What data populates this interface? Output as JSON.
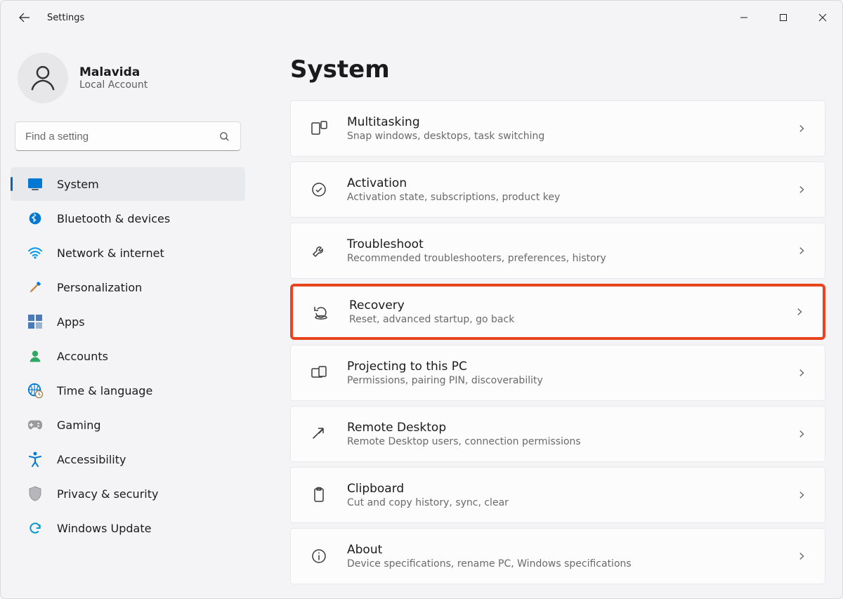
{
  "window": {
    "title": "Settings"
  },
  "profile": {
    "name": "Malavida",
    "account_type": "Local Account"
  },
  "search": {
    "placeholder": "Find a setting"
  },
  "nav": {
    "items": [
      {
        "id": "system",
        "label": "System",
        "selected": true
      },
      {
        "id": "bluetooth",
        "label": "Bluetooth & devices",
        "selected": false
      },
      {
        "id": "network",
        "label": "Network & internet",
        "selected": false
      },
      {
        "id": "personalization",
        "label": "Personalization",
        "selected": false
      },
      {
        "id": "apps",
        "label": "Apps",
        "selected": false
      },
      {
        "id": "accounts",
        "label": "Accounts",
        "selected": false
      },
      {
        "id": "time",
        "label": "Time & language",
        "selected": false
      },
      {
        "id": "gaming",
        "label": "Gaming",
        "selected": false
      },
      {
        "id": "accessibility",
        "label": "Accessibility",
        "selected": false
      },
      {
        "id": "privacy",
        "label": "Privacy & security",
        "selected": false
      },
      {
        "id": "update",
        "label": "Windows Update",
        "selected": false
      }
    ]
  },
  "page": {
    "title": "System",
    "cards": [
      {
        "id": "multitasking",
        "title": "Multitasking",
        "sub": "Snap windows, desktops, task switching",
        "highlighted": false
      },
      {
        "id": "activation",
        "title": "Activation",
        "sub": "Activation state, subscriptions, product key",
        "highlighted": false
      },
      {
        "id": "troubleshoot",
        "title": "Troubleshoot",
        "sub": "Recommended troubleshooters, preferences, history",
        "highlighted": false
      },
      {
        "id": "recovery",
        "title": "Recovery",
        "sub": "Reset, advanced startup, go back",
        "highlighted": true
      },
      {
        "id": "projecting",
        "title": "Projecting to this PC",
        "sub": "Permissions, pairing PIN, discoverability",
        "highlighted": false
      },
      {
        "id": "remote-desktop",
        "title": "Remote Desktop",
        "sub": "Remote Desktop users, connection permissions",
        "highlighted": false
      },
      {
        "id": "clipboard",
        "title": "Clipboard",
        "sub": "Cut and copy history, sync, clear",
        "highlighted": false
      },
      {
        "id": "about",
        "title": "About",
        "sub": "Device specifications, rename PC, Windows specifications",
        "highlighted": false
      }
    ]
  },
  "colors": {
    "accent": "#0067c0",
    "highlight": "#e8451f"
  }
}
